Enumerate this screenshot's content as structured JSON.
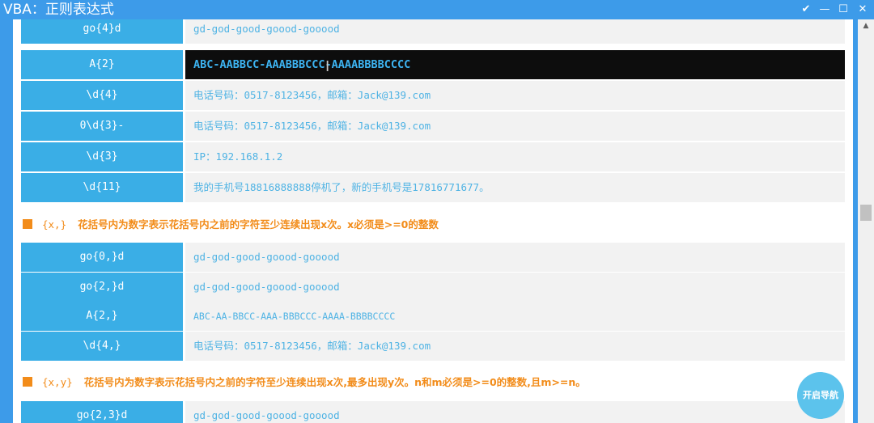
{
  "window": {
    "title": "VBA：正则表达式",
    "controls": {
      "check": "✔",
      "minimize": "—",
      "maximize": "☐",
      "close": "✕"
    }
  },
  "rows_top": [
    {
      "key": "go{4}d",
      "value": "gd-god-good-goood-gooood"
    },
    {
      "key": "A{2}",
      "value": "ABC-AABBCC-AAABBBCCC-AAAABBBBCCCC",
      "selected": true
    },
    {
      "key": "\\d{4}",
      "value": "电话号码：0517-8123456，邮箱：Jack@139.com"
    },
    {
      "key": "0\\d{3}-",
      "value": "电话号码：0517-8123456，邮箱：Jack@139.com"
    },
    {
      "key": "\\d{3}",
      "value": "IP：192.168.1.2"
    },
    {
      "key": "\\d{11}",
      "value": "我的手机号18816888888停机了，新的手机号是17816771677。"
    }
  ],
  "section_x_comma": {
    "syntax": "{x,}",
    "description": "花括号内为数字表示花括号内之前的字符至少连续出现x次。x必须是>=0的整数"
  },
  "rows_middle": [
    {
      "key": "go{0,}d",
      "value": "gd-god-good-goood-gooood"
    },
    {
      "key": "go{2,}d",
      "value": "gd-god-good-goood-gooood"
    },
    {
      "key": "A{2,}",
      "value": "ABC-AA-BBCC-AAA-BBBCCC-AAAA-BBBBCCCC"
    },
    {
      "key": "\\d{4,}",
      "value": "电话号码：0517-8123456，邮箱：Jack@139.com"
    }
  ],
  "section_x_y": {
    "syntax": "{x,y}",
    "description": "花括号内为数字表示花括号内之前的字符至少连续出现x次,最多出现y次。n和m必须是>=0的整数,且m>=n。"
  },
  "rows_bottom": [
    {
      "key": "go{2,3}d",
      "value": "gd-god-good-goood-gooood"
    }
  ],
  "nav_button": {
    "label": "开启导航"
  },
  "colors": {
    "window_accent": "#3d9be9",
    "key_cell": "#3aaee6",
    "value_text": "#4fb3e4",
    "heading": "#f28c1a",
    "highlight_bg": "#0d0d0d"
  }
}
